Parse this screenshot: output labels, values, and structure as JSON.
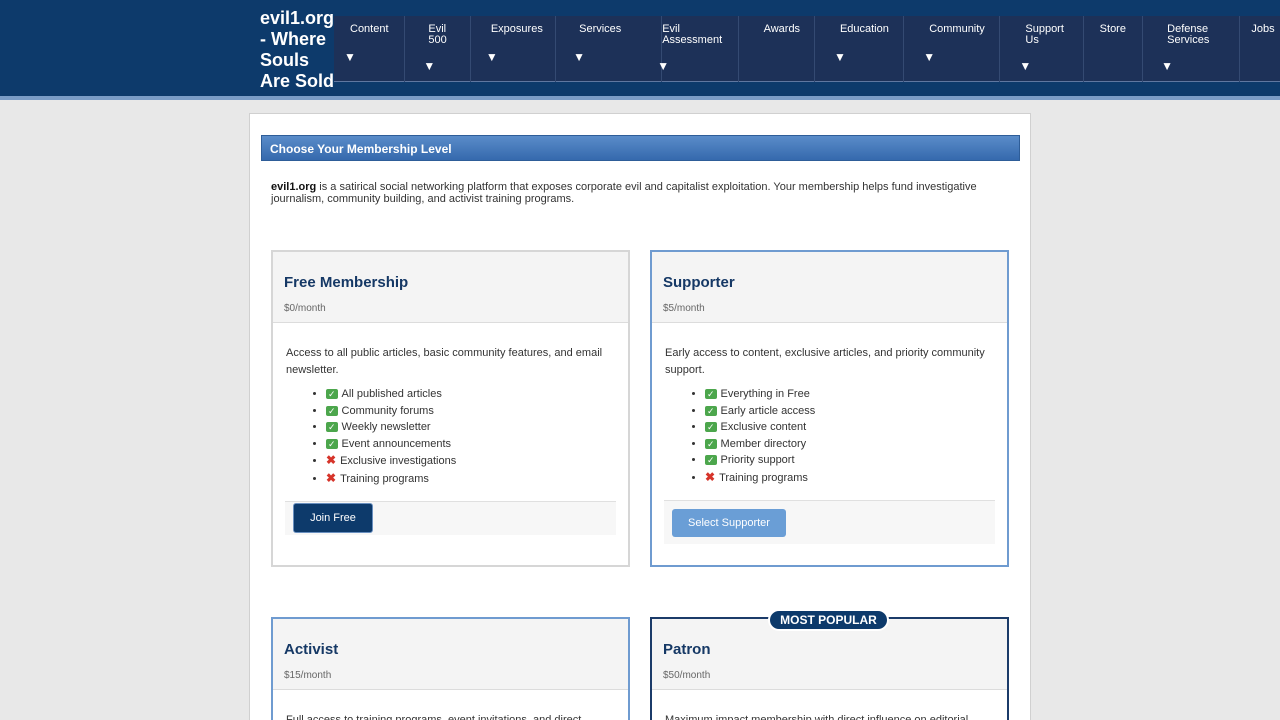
{
  "site": {
    "title": "evil1.org - Where Souls Are Sold"
  },
  "nav": [
    {
      "label": "Content",
      "arrow": "▼"
    },
    {
      "label": "Evil 500",
      "arrow": "▼"
    },
    {
      "label": "Exposures",
      "arrow": "▼"
    },
    {
      "label": "Services",
      "arrow": "▼"
    },
    {
      "label": "Evil Assessment",
      "arrow": "▼"
    },
    {
      "label": "Awards",
      "arrow": ""
    },
    {
      "label": "Education",
      "arrow": "▼"
    },
    {
      "label": "Community",
      "arrow": "▼"
    },
    {
      "label": "Support Us",
      "arrow": "▼"
    },
    {
      "label": "Store",
      "arrow": ""
    },
    {
      "label": "Defense Services",
      "arrow": "▼"
    },
    {
      "label": "Jobs",
      "arrow": ""
    }
  ],
  "panel": {
    "heading": "Choose Your Membership Level",
    "intro_bold": "evil1.org",
    "intro_rest": " is a satirical social networking platform that exposes corporate evil and capitalist exploitation. Your membership helps fund investigative journalism, community building, and activist training programs."
  },
  "cards": {
    "free": {
      "title": "Free Membership",
      "price": "$0/month",
      "desc": "Access to all public articles, basic community features, and email newsletter.",
      "features": [
        {
          "ok": true,
          "text": "All published articles"
        },
        {
          "ok": true,
          "text": "Community forums"
        },
        {
          "ok": true,
          "text": "Weekly newsletter"
        },
        {
          "ok": true,
          "text": "Event announcements"
        },
        {
          "ok": false,
          "text": "Exclusive investigations"
        },
        {
          "ok": false,
          "text": "Training programs"
        }
      ],
      "button": "Join Free"
    },
    "supporter": {
      "title": "Supporter",
      "price": "$5/month",
      "desc": "Early access to content, exclusive articles, and priority community support.",
      "features": [
        {
          "ok": true,
          "text": "Everything in Free"
        },
        {
          "ok": true,
          "text": "Early article access"
        },
        {
          "ok": true,
          "text": "Exclusive content"
        },
        {
          "ok": true,
          "text": "Member directory"
        },
        {
          "ok": true,
          "text": "Priority support"
        },
        {
          "ok": false,
          "text": "Training programs"
        }
      ],
      "button": "Select Supporter"
    },
    "activist": {
      "title": "Activist",
      "price": "$15/month",
      "desc": "Full access to training programs, event invitations, and direct"
    },
    "patron": {
      "title": "Patron",
      "price": "$50/month",
      "badge": "MOST POPULAR",
      "desc": "Maximum impact membership with direct influence on editorial"
    }
  },
  "icons": {
    "check": "✓",
    "cross": "✖"
  },
  "colors": {
    "header": "#0d3a6b",
    "nav": "#1d3158",
    "accent": "#3569ad",
    "button_primary": "#0d3a6b",
    "button_secondary": "#6a9ed6"
  }
}
